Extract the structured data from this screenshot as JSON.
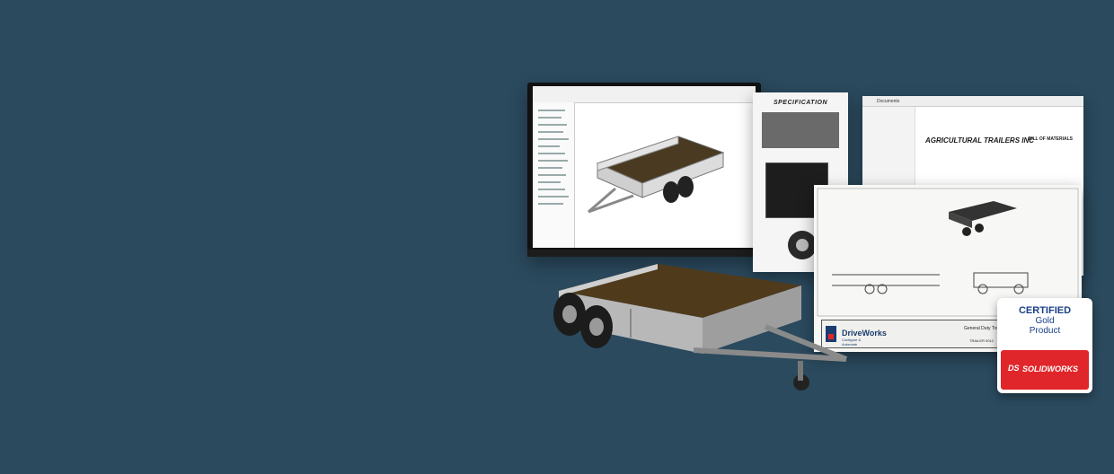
{
  "spec_sheet": {
    "title": "SPECIFICATION"
  },
  "bom": {
    "company": "AGRICULTURAL TRAILERS INC",
    "heading": "BILL OF MATERIALS",
    "window_title": "Documents"
  },
  "drawing": {
    "brand": "DriveWorks",
    "brand_tagline": "Configure & Automate",
    "part_title": "General Duty Trail",
    "part_number": "TRAILER 0012"
  },
  "badge": {
    "line1": "CERTIFIED",
    "line2": "Gold",
    "line3": "Product",
    "brand": "SOLIDWORKS",
    "brand_mark": "DS"
  },
  "colors": {
    "background": "#2b4a5e",
    "badge_red": "#e0262a",
    "badge_blue": "#1a3f86"
  }
}
